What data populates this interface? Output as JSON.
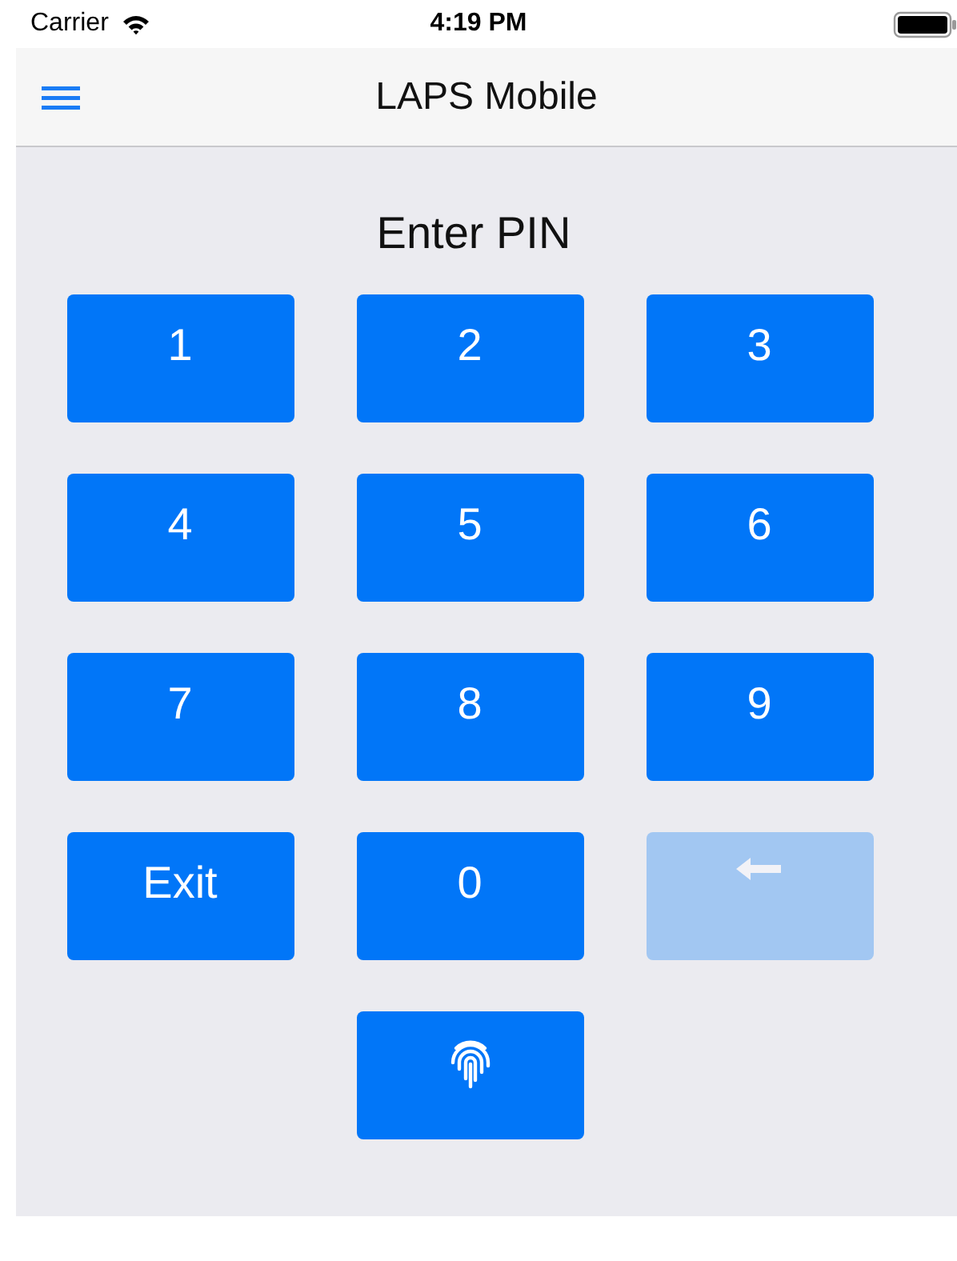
{
  "status_bar": {
    "carrier": "Carrier",
    "time": "4:19 PM"
  },
  "nav_bar": {
    "title": "LAPS Mobile"
  },
  "prompt": "Enter PIN",
  "keypad": [
    [
      {
        "kind": "label",
        "label": "1",
        "disabled": false
      },
      {
        "kind": "label",
        "label": "2",
        "disabled": false
      },
      {
        "kind": "label",
        "label": "3",
        "disabled": false
      }
    ],
    [
      {
        "kind": "label",
        "label": "4",
        "disabled": false
      },
      {
        "kind": "label",
        "label": "5",
        "disabled": false
      },
      {
        "kind": "label",
        "label": "6",
        "disabled": false
      }
    ],
    [
      {
        "kind": "label",
        "label": "7",
        "disabled": false
      },
      {
        "kind": "label",
        "label": "8",
        "disabled": false
      },
      {
        "kind": "label",
        "label": "9",
        "disabled": false
      }
    ],
    [
      {
        "kind": "label",
        "label": "Exit",
        "disabled": false
      },
      {
        "kind": "label",
        "label": "0",
        "disabled": false
      },
      {
        "kind": "backspace",
        "disabled": true
      }
    ],
    [
      {
        "kind": "empty"
      },
      {
        "kind": "fingerprint",
        "disabled": false
      },
      {
        "kind": "empty"
      }
    ]
  ]
}
